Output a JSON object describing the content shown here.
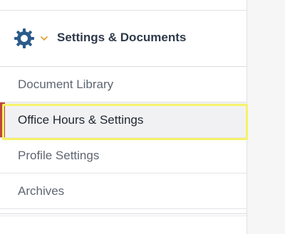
{
  "header": {
    "title": "Settings & Documents",
    "icon": "gear-icon",
    "icon_color": "#2b5b8a",
    "chevron_icon": "chevron-down-icon",
    "chevron_color": "#e0a13a"
  },
  "nav": {
    "items": [
      {
        "label": "Document Library",
        "active": false
      },
      {
        "label": "Office Hours & Settings",
        "active": true
      },
      {
        "label": "Profile Settings",
        "active": false
      },
      {
        "label": "Archives",
        "active": false
      }
    ]
  },
  "colors": {
    "active_indicator": "#c0443a",
    "highlight_outline": "#f6f26a",
    "heading_text": "#2f3a4b",
    "item_text": "#5e6672"
  }
}
